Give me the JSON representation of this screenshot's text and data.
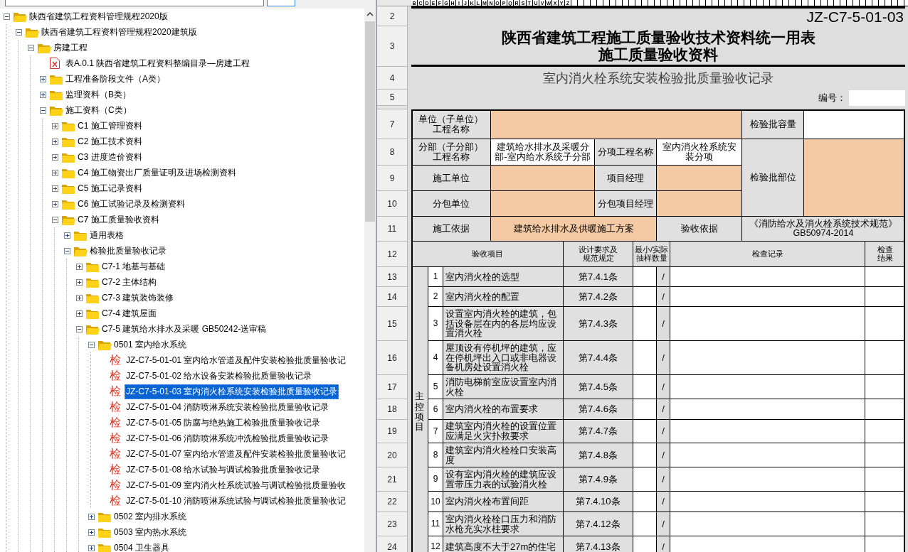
{
  "tree": [
    {
      "label": "陕西省建筑工程资料管理规程2020版",
      "kind": "folder",
      "expanded": true,
      "selected": false,
      "children": [
        {
          "label": "陕西省建筑工程资料管理规程2020建筑版",
          "kind": "folder",
          "expanded": true,
          "selected": false,
          "children": [
            {
              "label": "房建工程",
              "kind": "folder",
              "expanded": true,
              "selected": false,
              "children": [
                {
                  "label": "表A.0.1 陕西省建筑工程资料整编目录—房建工程",
                  "kind": "sheet",
                  "selected": false
                },
                {
                  "label": "工程准备阶段文件（A类）",
                  "kind": "folder",
                  "expanded": false,
                  "selected": false
                },
                {
                  "label": "监理资料（B类）",
                  "kind": "folder",
                  "expanded": false,
                  "selected": false
                },
                {
                  "label": "施工资料（C类）",
                  "kind": "folder",
                  "expanded": true,
                  "selected": false,
                  "children": [
                    {
                      "label": "C1  施工管理资料",
                      "kind": "folder",
                      "expanded": false,
                      "selected": false
                    },
                    {
                      "label": "C2  施工技术资料",
                      "kind": "folder",
                      "expanded": false,
                      "selected": false
                    },
                    {
                      "label": "C3  进度造价资料",
                      "kind": "folder",
                      "expanded": false,
                      "selected": false
                    },
                    {
                      "label": "C4  施工物资出厂质量证明及进场检测资料",
                      "kind": "folder",
                      "expanded": false,
                      "selected": false
                    },
                    {
                      "label": "C5  施工记录资料",
                      "kind": "folder",
                      "expanded": false,
                      "selected": false
                    },
                    {
                      "label": "C6  施工试验记录及检测资料",
                      "kind": "folder",
                      "expanded": false,
                      "selected": false
                    },
                    {
                      "label": "C7  施工质量验收资料",
                      "kind": "folder",
                      "expanded": true,
                      "selected": false,
                      "children": [
                        {
                          "label": "通用表格",
                          "kind": "folder",
                          "expanded": false,
                          "selected": false
                        },
                        {
                          "label": "检验批质量验收记录",
                          "kind": "folder",
                          "expanded": true,
                          "selected": false,
                          "children": [
                            {
                              "label": "C7-1  地基与基础",
                              "kind": "folder",
                              "expanded": false,
                              "selected": false
                            },
                            {
                              "label": "C7-2  主体结构",
                              "kind": "folder",
                              "expanded": false,
                              "selected": false
                            },
                            {
                              "label": "C7-3  建筑装饰装修",
                              "kind": "folder",
                              "expanded": false,
                              "selected": false
                            },
                            {
                              "label": "C7-4  建筑屋面",
                              "kind": "folder",
                              "expanded": false,
                              "selected": false
                            },
                            {
                              "label": "C7-5  建筑给水排水及采暖 GB50242-送审稿",
                              "kind": "folder",
                              "expanded": true,
                              "selected": false,
                              "children": [
                                {
                                  "label": "0501  室内给水系统",
                                  "kind": "folder",
                                  "expanded": true,
                                  "selected": false,
                                  "children": [
                                    {
                                      "label": "JZ-C7-5-01-01 室内给水管道及配件安装检验批质量验收记",
                                      "kind": "check",
                                      "icon": "检",
                                      "selected": false
                                    },
                                    {
                                      "label": "JZ-C7-5-01-02 给水设备安装检验批质量验收记录",
                                      "kind": "check",
                                      "icon": "检",
                                      "selected": false
                                    },
                                    {
                                      "label": "JZ-C7-5-01-03 室内消火栓系统安装检验批质量验收记录",
                                      "kind": "check",
                                      "icon": "检",
                                      "selected": true
                                    },
                                    {
                                      "label": "JZ-C7-5-01-04 消防喷淋系统安装检验批质量验收记录",
                                      "kind": "check",
                                      "icon": "检",
                                      "selected": false
                                    },
                                    {
                                      "label": "JZ-C7-5-01-05 防腐与绝热施工检验批质量验收记录",
                                      "kind": "check",
                                      "icon": "检",
                                      "selected": false
                                    },
                                    {
                                      "label": "JZ-C7-5-01-06 消防喷淋系统冲洗检验批质量验收记录",
                                      "kind": "check",
                                      "icon": "检",
                                      "selected": false
                                    },
                                    {
                                      "label": "JZ-C7-5-01-07 室内给水管道及配件安装检验批质量验收记",
                                      "kind": "check",
                                      "icon": "检",
                                      "selected": false
                                    },
                                    {
                                      "label": "JZ-C7-5-01-08 给水试验与调试检验批质量验收记录",
                                      "kind": "check",
                                      "icon": "检",
                                      "selected": false
                                    },
                                    {
                                      "label": "JZ-C7-5-01-09 室内消火栓系统试验与调试检验批质量验收",
                                      "kind": "check",
                                      "icon": "检",
                                      "selected": false
                                    },
                                    {
                                      "label": "JZ-C7-5-01-10 消防喷淋系统试验与调试检验批质量验收记",
                                      "kind": "check",
                                      "icon": "检",
                                      "selected": false
                                    }
                                  ]
                                },
                                {
                                  "label": "0502  室内排水系统",
                                  "kind": "folder",
                                  "expanded": false,
                                  "selected": false
                                },
                                {
                                  "label": "0503  室内热水系统",
                                  "kind": "folder",
                                  "expanded": false,
                                  "selected": false
                                },
                                {
                                  "label": "0504  卫生器具",
                                  "kind": "folder",
                                  "expanded": false,
                                  "selected": false
                                }
                              ]
                            }
                          ]
                        }
                      ]
                    }
                  ]
                }
              ]
            }
          ]
        }
      ]
    }
  ],
  "sheet": {
    "column_letters": [
      "B",
      "C",
      "D",
      "E",
      "F",
      "G",
      "H",
      "I",
      "J",
      "K",
      "L",
      "M",
      "N",
      "O",
      "P",
      "Q",
      "R",
      "S",
      "T",
      "U",
      "V",
      "W",
      "X",
      "Y",
      "Z"
    ],
    "row_numbers": [
      "2",
      "3",
      "4",
      "5",
      "7",
      "8",
      "9",
      "10",
      "11",
      "12",
      "13",
      "14",
      "15",
      "16",
      "17",
      "18",
      "19",
      "20",
      "21",
      "22",
      "23",
      "24"
    ],
    "code": "JZ-C7-5-01-03",
    "title": [
      "陕西省建筑工程施工质量验收技术资料统一用表",
      "施工质量验收资料"
    ],
    "subtitle": "室内消火栓系统安装检验批质量验收记录",
    "number_label": "编号：",
    "info": {
      "unit_label": [
        "单位（子单位）",
        "工程名称"
      ],
      "capacity_label": "检验批容量",
      "division_label": [
        "分部（子分部）",
        "工程名称"
      ],
      "division_value": [
        "建筑给水排水及采暖分",
        "部-室内给水系统子分部"
      ],
      "subitem_label": "分项工程名称",
      "subitem_value": [
        "室内消火栓系统安",
        "装分项"
      ],
      "location_label": "检验批部位",
      "contractor_label": "施工单位",
      "manager_label": "项目经理",
      "subcontractor_label": "分包单位",
      "sub_manager_label": "分包项目经理",
      "basis_label": "施工依据",
      "basis_value": "建筑给水排水及供暖施工方案",
      "acceptance_label": "验收依据",
      "acceptance_value": [
        "《消防给水及消火栓系统技术规范》",
        "GB50974-2014"
      ]
    },
    "columns": [
      [
        "验收项目"
      ],
      [
        "设计要求及",
        "规范规定"
      ],
      [
        "最小/实际",
        "抽样数量"
      ],
      [
        "检查记录"
      ],
      [
        "检查",
        "结果"
      ]
    ],
    "main_control_label": "主控项目",
    "items": [
      {
        "no": "1",
        "text": "室内消火栓的选型",
        "clause": "第7.4.1条",
        "sample": "/"
      },
      {
        "no": "2",
        "text": "室内消火栓的配置",
        "clause": "第7.4.2条",
        "sample": "/"
      },
      {
        "no": "3",
        "text": "设置室内消火栓的建筑，包括设备层在内的各层均应设置消火栓",
        "clause": "第7.4.3条",
        "sample": "/"
      },
      {
        "no": "4",
        "text": "屋顶设有停机坪的建筑，应在停机坪出入口或非电器设备机房处设置消火栓",
        "clause": "第7.4.4条",
        "sample": "/"
      },
      {
        "no": "5",
        "text": "消防电梯前室应设置室内消火栓",
        "clause": "第7.4.5条",
        "sample": "/"
      },
      {
        "no": "6",
        "text": "室内消火栓的布置要求",
        "clause": "第7.4.6条",
        "sample": "/"
      },
      {
        "no": "7",
        "text": "建筑室内消火栓的设置位置应满足火灾扑救要求",
        "clause": "第7.4.7条",
        "sample": "/"
      },
      {
        "no": "8",
        "text": "建筑室内消火栓栓口安装高度",
        "clause": "第7.4.8条",
        "sample": "/"
      },
      {
        "no": "9",
        "text": "设有室内消火栓的建筑应设置带压力表的试验消火栓",
        "clause": "第7.4.9条",
        "sample": "/"
      },
      {
        "no": "10",
        "text": "室内消火栓布置间距",
        "clause": "第7.4.10条",
        "sample": "/"
      },
      {
        "no": "11",
        "text": "室内消火栓栓口压力和消防水枪充实水柱要求",
        "clause": "第7.4.12条",
        "sample": "/"
      },
      {
        "no": "12",
        "text": "建筑高度不大于27m的住宅",
        "clause": "第7.4.13条",
        "sample": "/"
      }
    ]
  }
}
